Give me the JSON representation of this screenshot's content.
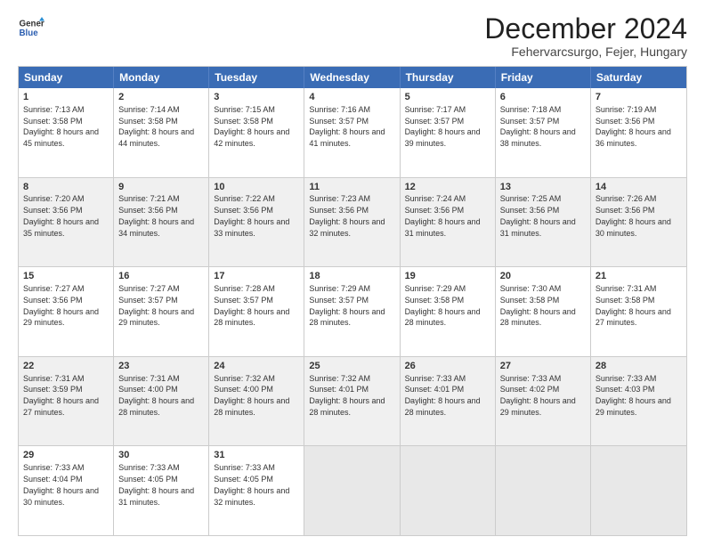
{
  "logo": {
    "line1": "General",
    "line2": "Blue"
  },
  "title": "December 2024",
  "location": "Fehervarcsurgo, Fejer, Hungary",
  "days_of_week": [
    "Sunday",
    "Monday",
    "Tuesday",
    "Wednesday",
    "Thursday",
    "Friday",
    "Saturday"
  ],
  "weeks": [
    [
      {
        "day": 1,
        "sunrise": "7:13 AM",
        "sunset": "3:58 PM",
        "daylight": "8 hours and 45 minutes."
      },
      {
        "day": 2,
        "sunrise": "7:14 AM",
        "sunset": "3:58 PM",
        "daylight": "8 hours and 44 minutes."
      },
      {
        "day": 3,
        "sunrise": "7:15 AM",
        "sunset": "3:58 PM",
        "daylight": "8 hours and 42 minutes."
      },
      {
        "day": 4,
        "sunrise": "7:16 AM",
        "sunset": "3:57 PM",
        "daylight": "8 hours and 41 minutes."
      },
      {
        "day": 5,
        "sunrise": "7:17 AM",
        "sunset": "3:57 PM",
        "daylight": "8 hours and 39 minutes."
      },
      {
        "day": 6,
        "sunrise": "7:18 AM",
        "sunset": "3:57 PM",
        "daylight": "8 hours and 38 minutes."
      },
      {
        "day": 7,
        "sunrise": "7:19 AM",
        "sunset": "3:56 PM",
        "daylight": "8 hours and 36 minutes."
      }
    ],
    [
      {
        "day": 8,
        "sunrise": "7:20 AM",
        "sunset": "3:56 PM",
        "daylight": "8 hours and 35 minutes."
      },
      {
        "day": 9,
        "sunrise": "7:21 AM",
        "sunset": "3:56 PM",
        "daylight": "8 hours and 34 minutes."
      },
      {
        "day": 10,
        "sunrise": "7:22 AM",
        "sunset": "3:56 PM",
        "daylight": "8 hours and 33 minutes."
      },
      {
        "day": 11,
        "sunrise": "7:23 AM",
        "sunset": "3:56 PM",
        "daylight": "8 hours and 32 minutes."
      },
      {
        "day": 12,
        "sunrise": "7:24 AM",
        "sunset": "3:56 PM",
        "daylight": "8 hours and 31 minutes."
      },
      {
        "day": 13,
        "sunrise": "7:25 AM",
        "sunset": "3:56 PM",
        "daylight": "8 hours and 31 minutes."
      },
      {
        "day": 14,
        "sunrise": "7:26 AM",
        "sunset": "3:56 PM",
        "daylight": "8 hours and 30 minutes."
      }
    ],
    [
      {
        "day": 15,
        "sunrise": "7:27 AM",
        "sunset": "3:56 PM",
        "daylight": "8 hours and 29 minutes."
      },
      {
        "day": 16,
        "sunrise": "7:27 AM",
        "sunset": "3:57 PM",
        "daylight": "8 hours and 29 minutes."
      },
      {
        "day": 17,
        "sunrise": "7:28 AM",
        "sunset": "3:57 PM",
        "daylight": "8 hours and 28 minutes."
      },
      {
        "day": 18,
        "sunrise": "7:29 AM",
        "sunset": "3:57 PM",
        "daylight": "8 hours and 28 minutes."
      },
      {
        "day": 19,
        "sunrise": "7:29 AM",
        "sunset": "3:58 PM",
        "daylight": "8 hours and 28 minutes."
      },
      {
        "day": 20,
        "sunrise": "7:30 AM",
        "sunset": "3:58 PM",
        "daylight": "8 hours and 28 minutes."
      },
      {
        "day": 21,
        "sunrise": "7:31 AM",
        "sunset": "3:58 PM",
        "daylight": "8 hours and 27 minutes."
      }
    ],
    [
      {
        "day": 22,
        "sunrise": "7:31 AM",
        "sunset": "3:59 PM",
        "daylight": "8 hours and 27 minutes."
      },
      {
        "day": 23,
        "sunrise": "7:31 AM",
        "sunset": "4:00 PM",
        "daylight": "8 hours and 28 minutes."
      },
      {
        "day": 24,
        "sunrise": "7:32 AM",
        "sunset": "4:00 PM",
        "daylight": "8 hours and 28 minutes."
      },
      {
        "day": 25,
        "sunrise": "7:32 AM",
        "sunset": "4:01 PM",
        "daylight": "8 hours and 28 minutes."
      },
      {
        "day": 26,
        "sunrise": "7:33 AM",
        "sunset": "4:01 PM",
        "daylight": "8 hours and 28 minutes."
      },
      {
        "day": 27,
        "sunrise": "7:33 AM",
        "sunset": "4:02 PM",
        "daylight": "8 hours and 29 minutes."
      },
      {
        "day": 28,
        "sunrise": "7:33 AM",
        "sunset": "4:03 PM",
        "daylight": "8 hours and 29 minutes."
      }
    ],
    [
      {
        "day": 29,
        "sunrise": "7:33 AM",
        "sunset": "4:04 PM",
        "daylight": "8 hours and 30 minutes."
      },
      {
        "day": 30,
        "sunrise": "7:33 AM",
        "sunset": "4:05 PM",
        "daylight": "8 hours and 31 minutes."
      },
      {
        "day": 31,
        "sunrise": "7:33 AM",
        "sunset": "4:05 PM",
        "daylight": "8 hours and 32 minutes."
      },
      null,
      null,
      null,
      null
    ]
  ]
}
